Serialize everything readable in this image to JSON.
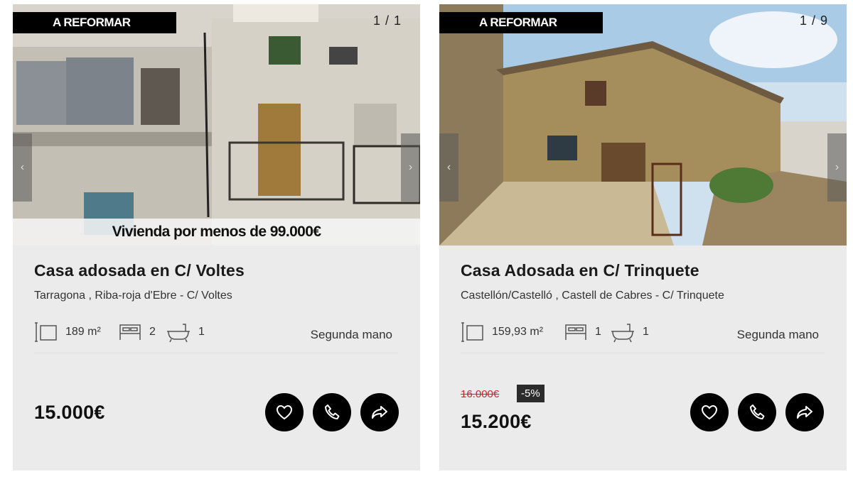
{
  "cards": [
    {
      "badge": "A REFORMAR",
      "counter": "1 / 1",
      "promo": "Vivienda por menos de 99.000€",
      "title": "Casa adosada en C/ Voltes",
      "location": "Tarragona , Riba-roja d'Ebre - C/ Voltes",
      "area": "189 m²",
      "bedrooms": "2",
      "bathrooms": "1",
      "condition": "Segunda mano",
      "price": "15.000€"
    },
    {
      "badge": "A REFORMAR",
      "counter": "1 / 9",
      "title": "Casa Adosada en C/ Trinquete",
      "location": "Castellón/Castelló , Castell de Cabres - C/ Trinquete",
      "area": "159,93 m²",
      "bedrooms": "1",
      "bathrooms": "1",
      "condition": "Segunda mano",
      "old_price": "16.000€",
      "discount": "-5%",
      "price": "15.200€"
    }
  ],
  "icons": {
    "area": "area-icon",
    "bed": "bed-icon",
    "bath": "bath-icon",
    "favorite": "heart-icon",
    "call": "phone-icon",
    "share": "share-icon"
  },
  "colors": {
    "card_bg": "#ebebeb",
    "badge_bg": "#000000",
    "button_bg": "#000000",
    "old_price": "#c42a2a",
    "discount_bg": "#2b2b2b"
  }
}
